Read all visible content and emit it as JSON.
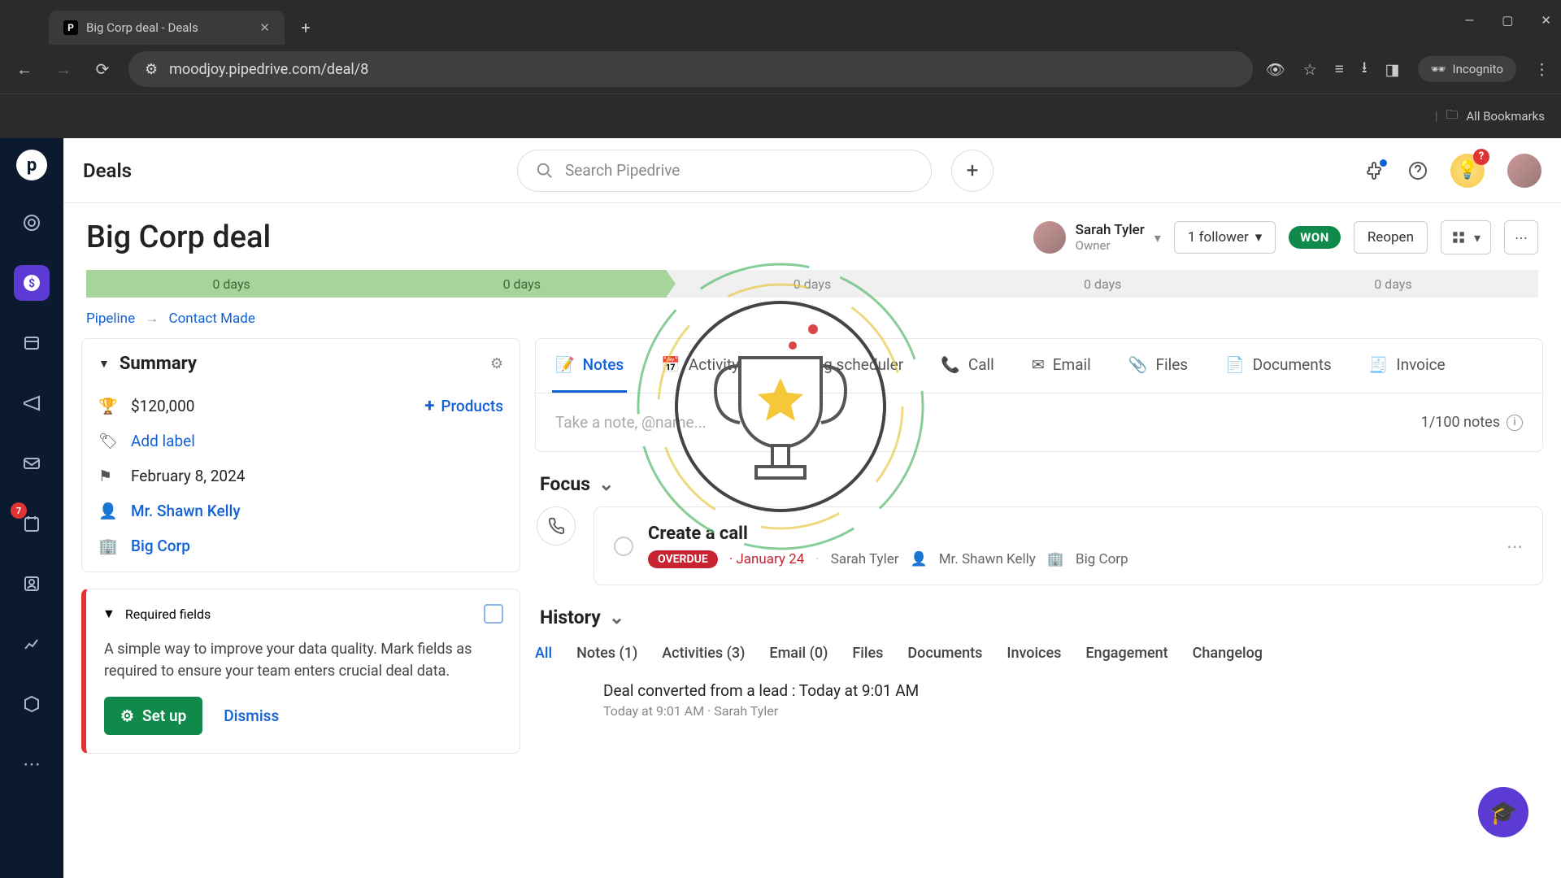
{
  "browser": {
    "tab_title": "Big Corp deal - Deals",
    "url": "moodjoy.pipedrive.com/deal/8",
    "incognito": "Incognito",
    "bookmarks": "All Bookmarks"
  },
  "rail": {
    "badge_count": "7"
  },
  "topbar": {
    "crumb": "Deals",
    "search_placeholder": "Search Pipedrive",
    "bulb_badge": "?"
  },
  "deal": {
    "title": "Big Corp deal",
    "owner_name": "Sarah Tyler",
    "owner_role": "Owner",
    "followers": "1 follower",
    "status": "WON",
    "reopen": "Reopen"
  },
  "stages": [
    "0 days",
    "0 days",
    "0 days",
    "0 days",
    "0 days"
  ],
  "breadcrumb": {
    "pipeline": "Pipeline",
    "stage": "Contact Made"
  },
  "summary": {
    "title": "Summary",
    "value": "$120,000",
    "products": "Products",
    "add_label": "Add label",
    "date": "February 8, 2024",
    "contact": "Mr. Shawn Kelly",
    "org": "Big Corp"
  },
  "required": {
    "title": "Required fields",
    "desc": "A simple way to improve your data quality. Mark fields as required to ensure your team enters crucial deal data.",
    "setup": "Set up",
    "dismiss": "Dismiss"
  },
  "tabs": {
    "notes": "Notes",
    "activity": "Activity",
    "scheduler": "Meeting scheduler",
    "call": "Call",
    "email": "Email",
    "files": "Files",
    "documents": "Documents",
    "invoice": "Invoice",
    "note_placeholder": "Take a note, @name...",
    "note_count": "1/100 notes"
  },
  "focus": {
    "header": "Focus",
    "card_title": "Create a call",
    "overdue": "OVERDUE",
    "date": "January 24",
    "owner": "Sarah Tyler",
    "contact": "Mr. Shawn Kelly",
    "org": "Big Corp"
  },
  "history": {
    "header": "History",
    "tabs": {
      "all": "All",
      "notes": "Notes (1)",
      "activities": "Activities (3)",
      "email": "Email (0)",
      "files": "Files",
      "documents": "Documents",
      "invoices": "Invoices",
      "engagement": "Engagement",
      "changelog": "Changelog"
    },
    "item1_title": "Deal converted from a lead : Today at 9:01 AM",
    "item1_sub": "Today at 9:01 AM · Sarah Tyler"
  }
}
